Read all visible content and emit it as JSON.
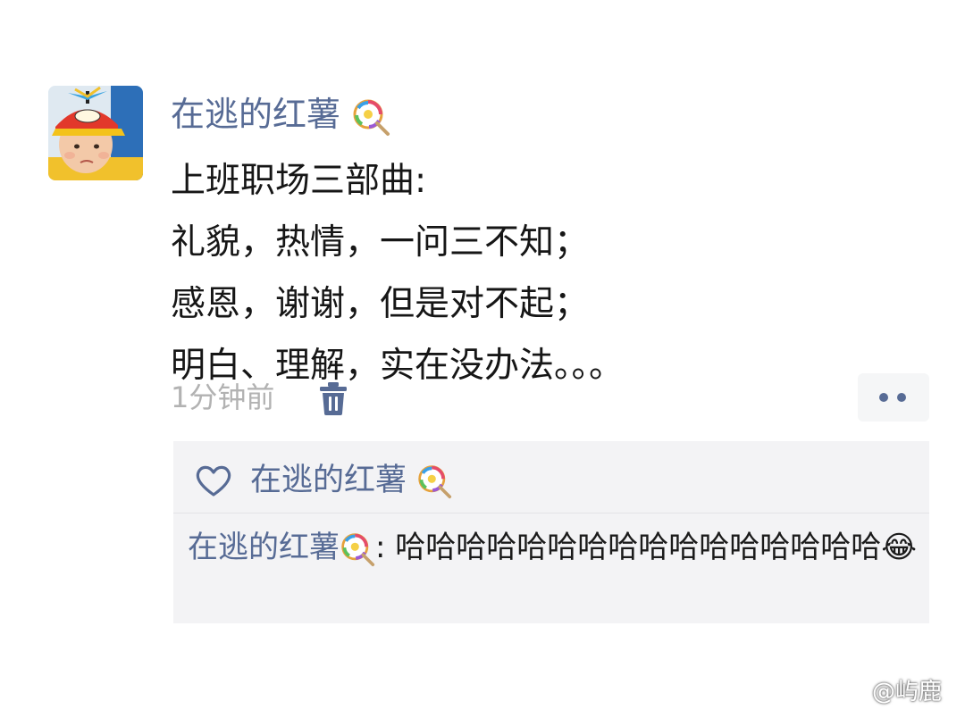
{
  "post": {
    "username": "在逃的红薯",
    "username_emoji": "lollipop-icon",
    "lines": [
      "上班职场三部曲:",
      "礼貌，热情，一问三不知；",
      "感恩，谢谢，但是对不起；",
      "明白、理解，实在没办法。。。"
    ],
    "time": "1分钟前"
  },
  "interaction": {
    "liker": "在逃的红薯",
    "comment": {
      "author": "在逃的红薯",
      "separator": ": ",
      "text": "哈哈哈哈哈哈哈哈哈哈哈哈哈哈哈哈",
      "emoji": "😂"
    }
  },
  "watermark": {
    "text": "@屿鹿",
    "icon": "weibo-icon"
  },
  "colors": {
    "link": "#576b95",
    "meta": "#b2b2b2",
    "panel": "#f3f3f5"
  }
}
